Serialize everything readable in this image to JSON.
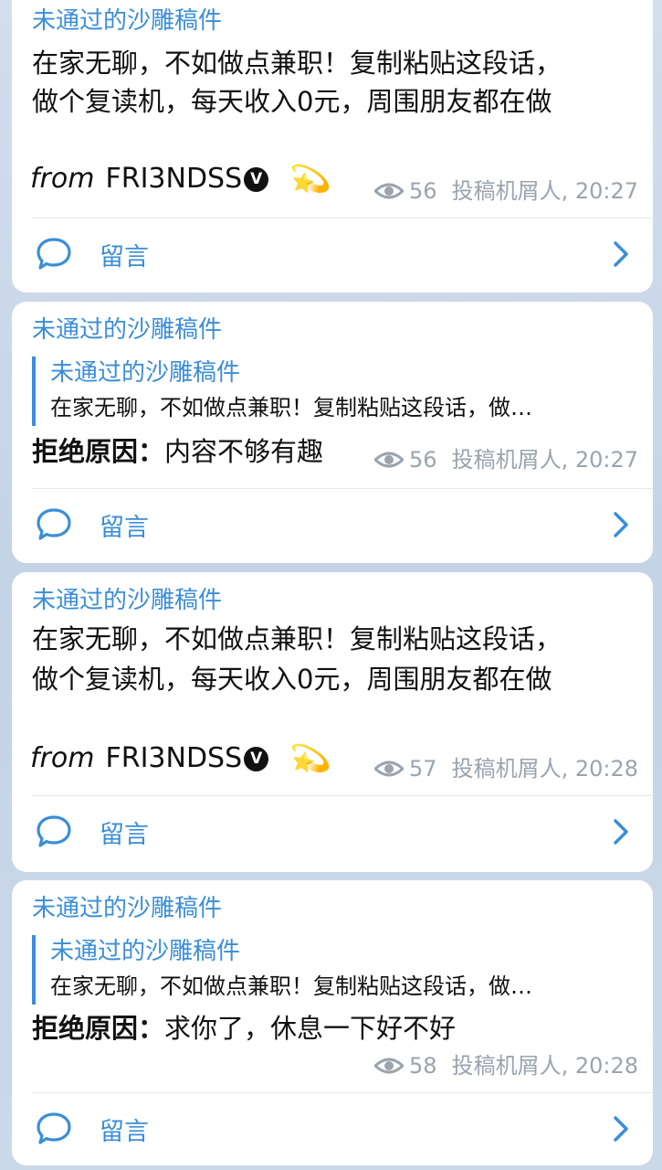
{
  "messages": [
    {
      "channel": "未通过的沙雕稿件",
      "text_line1": "在家无聊，不如做点兼职！复制粘贴这段话，",
      "text_line2": "做个复读机，每天收入0元，周围朋友都在做",
      "from_word": "from",
      "from_name": "FRI3NDSS",
      "verified_badge": "V",
      "emoji": "💫",
      "views": "56",
      "meta": "投稿机屑人, 20:27",
      "comment_label": "留言"
    },
    {
      "channel": "未通过的沙雕稿件",
      "quote_title": "未通过的沙雕稿件",
      "quote_text": "在家无聊，不如做点兼职！复制粘贴这段话，做…",
      "reason_label": "拒绝原因：",
      "reason_text": "内容不够有趣",
      "views": "56",
      "meta": "投稿机屑人, 20:27",
      "comment_label": "留言"
    },
    {
      "channel": "未通过的沙雕稿件",
      "text_line1": "在家无聊，不如做点兼职！复制粘贴这段话，",
      "text_line2": "做个复读机，每天收入0元，周围朋友都在做",
      "from_word": "from",
      "from_name": "FRI3NDSS",
      "verified_badge": "V",
      "emoji": "💫",
      "views": "57",
      "meta": "投稿机屑人, 20:28",
      "comment_label": "留言"
    },
    {
      "channel": "未通过的沙雕稿件",
      "quote_title": "未通过的沙雕稿件",
      "quote_text": "在家无聊，不如做点兼职！复制粘贴这段话，做…",
      "reason_label": "拒绝原因：",
      "reason_text": "求你了，休息一下好不好",
      "views": "58",
      "meta": "投稿机屑人, 20:28",
      "comment_label": "留言"
    }
  ],
  "colors": {
    "accent": "#3a8ed8",
    "meta": "#9aa4ad",
    "background": "#c9d6e6"
  },
  "icons": {
    "views": "eye-icon",
    "comment": "chat-bubble-icon",
    "chevron": "chevron-right-icon"
  }
}
